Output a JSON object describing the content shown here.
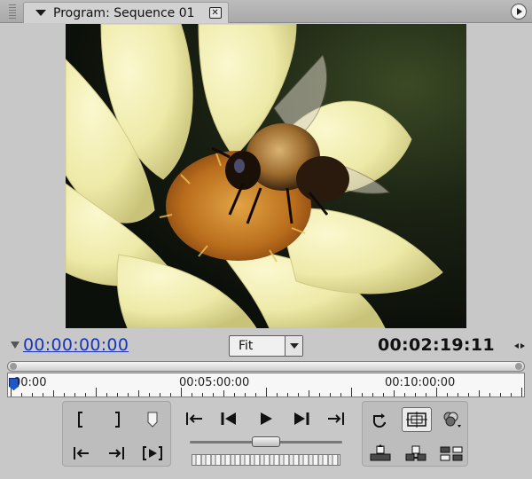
{
  "panel": {
    "tab_title": "Program: Sequence 01",
    "close_glyph": "✕",
    "menu_icon": "panel-menu-icon"
  },
  "viewer": {
    "content": "video-frame"
  },
  "timecode": {
    "current": "00:00:00:00",
    "duration": "00:02:19:11",
    "zoom_level": "Fit"
  },
  "ruler": {
    "labels": [
      "00:00",
      "00:05:00:00",
      "00:10:00:00"
    ],
    "playhead_fraction": 0.0
  },
  "transport": {
    "edit_group": [
      "mark-in-icon",
      "mark-out-icon",
      "set-marker-icon",
      "go-to-in-icon",
      "go-to-out-icon",
      "play-in-to-out-icon"
    ],
    "playback_group": [
      "step-to-in-icon",
      "step-back-icon",
      "play-icon",
      "step-forward-icon",
      "step-to-out-icon"
    ],
    "tools_group": [
      "loop-icon",
      "safe-margins-icon",
      "output-icon",
      "lift-icon",
      "extract-icon",
      "trim-icon"
    ],
    "shuttle_position": 0.5
  },
  "colors": {
    "timecode_link": "#1a34b8",
    "playhead": "#1d57c9",
    "panel_bg": "#c8c8c8"
  }
}
